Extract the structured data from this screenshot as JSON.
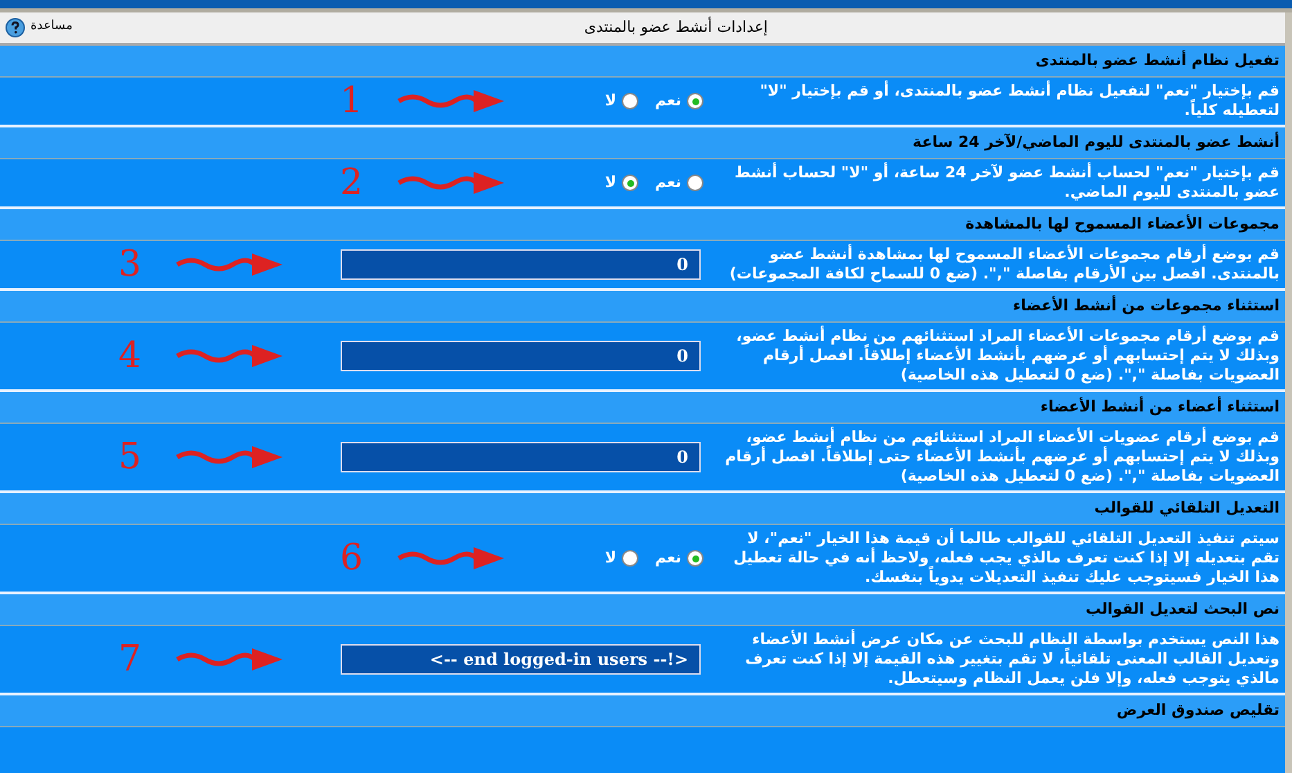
{
  "title": "إعدادات أنشط عضو بالمنتدى",
  "help": {
    "label": "مساعدة"
  },
  "settings": [
    {
      "title": "تفعيل نظام أنشط عضو بالمنتدى",
      "description": "قم بإختيار \"نعم\" لتفعيل نظام أنشط عضو بالمنتدى، أو قم بإختيار \"لا\" لتعطيله كلياً.",
      "control": {
        "kind": "radio",
        "options": [
          {
            "label": "نعم",
            "selected": true
          },
          {
            "label": "لا",
            "selected": false
          }
        ]
      },
      "annotation": "1"
    },
    {
      "title": "أنشط عضو بالمنتدى لليوم الماضي/لآخر 24 ساعة",
      "description": "قم بإختيار \"نعم\" لحساب أنشط عضو لآخر 24 ساعة، أو \"لا\" لحساب أنشط عضو بالمنتدى لليوم الماضي.",
      "control": {
        "kind": "radio",
        "options": [
          {
            "label": "نعم",
            "selected": false
          },
          {
            "label": "لا",
            "selected": true
          }
        ]
      },
      "annotation": "2"
    },
    {
      "title": "مجموعات الأعضاء المسموح لها بالمشاهدة",
      "description": "قم بوضع أرقام مجموعات الأعضاء المسموح لها بمشاهدة أنشط عضو بالمنتدى. افصل بين الأرقام بفاصلة \",\". (ضع 0 للسماح لكافة المجموعات)",
      "control": {
        "kind": "text",
        "value": "0"
      },
      "annotation": "3"
    },
    {
      "title": "استثناء مجموعات من أنشط الأعضاء",
      "description": "قم بوضع أرقام مجموعات الأعضاء المراد استثنائهم من نظام أنشط عضو، وبذلك لا يتم إحتسابهم أو عرضهم بأنشط الأعضاء إطلاقاً. افصل أرقام العضويات بفاصلة \",\". (ضع 0 لتعطيل هذه الخاصية)",
      "control": {
        "kind": "text",
        "value": "0"
      },
      "annotation": "4"
    },
    {
      "title": "استثناء أعضاء من أنشط الأعضاء",
      "description": "قم بوضع أرقام عضويات الأعضاء المراد استثنائهم من نظام أنشط عضو، وبذلك لا يتم إحتسابهم أو عرضهم بأنشط الأعضاء حتى إطلاقاً. افصل أرقام العضويات بفاصلة \",\". (ضع 0 لتعطيل هذه الخاصية)",
      "control": {
        "kind": "text",
        "value": "0"
      },
      "annotation": "5"
    },
    {
      "title": "التعديل التلقائي للقوالب",
      "description": "سيتم تنفيذ التعديل التلقائي للقوالب طالما أن قيمة هذا الخيار \"نعم\"، لا تقم بتعديله إلا إذا كنت تعرف مالذي يجب فعله، ولاحظ أنه في حالة تعطيل هذا الخيار فسيتوجب عليك تنفيذ التعديلات يدوياً بنفسك.",
      "control": {
        "kind": "radio",
        "options": [
          {
            "label": "نعم",
            "selected": true
          },
          {
            "label": "لا",
            "selected": false
          }
        ]
      },
      "annotation": "6"
    },
    {
      "title": "نص البحث لتعديل القوالب",
      "description": "هذا النص يستخدم بواسطة النظام للبحث عن مكان عرض أنشط الأعضاء وتعديل القالب المعنى تلقائياً، لا تقم بتغيير هذه القيمة إلا إذا كنت تعرف مالذي يتوجب فعله، وإلا فلن يعمل النظام وسيتعطل.",
      "control": {
        "kind": "text",
        "value": "<!-- end logged-in users -->"
      },
      "annotation": "7"
    },
    {
      "title": "تقليص صندوق العرض"
    }
  ]
}
